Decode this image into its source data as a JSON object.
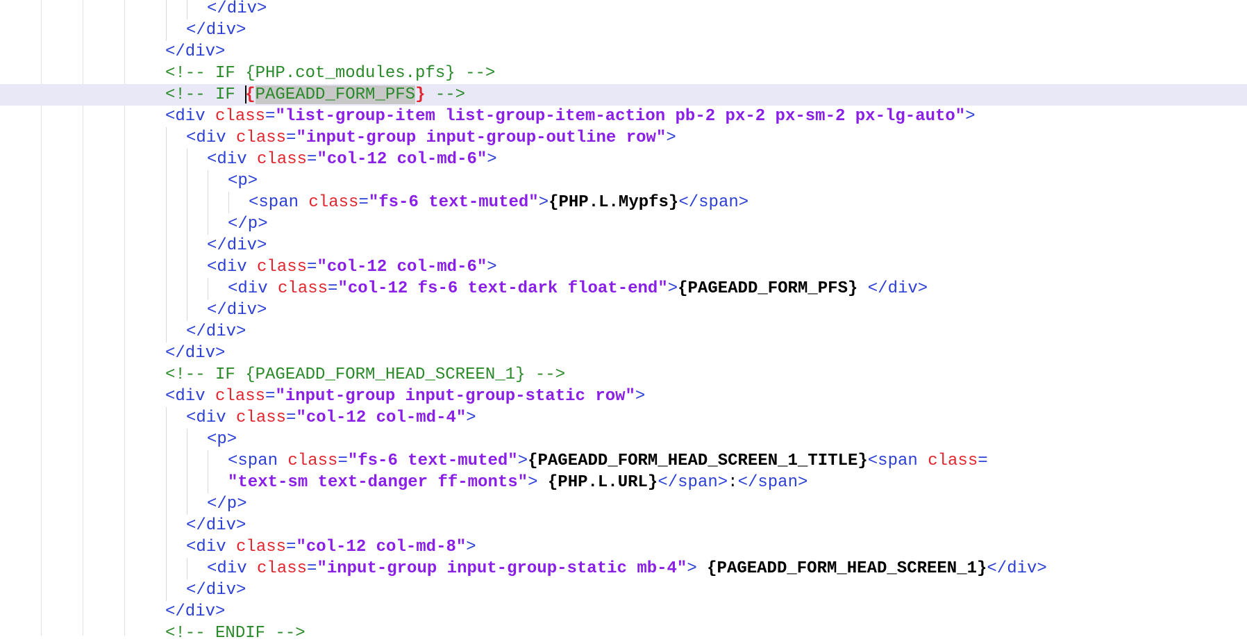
{
  "editor": {
    "lines": [
      {
        "indent": 10,
        "tokens": [
          {
            "k": "tag",
            "t": "</div>"
          }
        ]
      },
      {
        "indent": 9,
        "tokens": [
          {
            "k": "tag",
            "t": "</div>"
          }
        ]
      },
      {
        "indent": 8,
        "tokens": [
          {
            "k": "tag",
            "t": "</div>"
          }
        ]
      },
      {
        "indent": 8,
        "tokens": [
          {
            "k": "cmt",
            "t": "<!-- IF {PHP.cot_modules.pfs} -->"
          }
        ]
      },
      {
        "indent": 8,
        "current": true,
        "tokens": [
          {
            "k": "cmt",
            "t": "<!-- IF "
          },
          {
            "k": "caret",
            "t": ""
          },
          {
            "k": "brace",
            "t": "{"
          },
          {
            "k": "sel",
            "t": "PAGEADD_FORM_PFS"
          },
          {
            "k": "brace",
            "t": "}"
          },
          {
            "k": "cmt",
            "t": " -->"
          }
        ]
      },
      {
        "indent": 8,
        "tokens": [
          {
            "k": "tag",
            "t": "<div "
          },
          {
            "k": "attr",
            "t": "class"
          },
          {
            "k": "eq",
            "t": "="
          },
          {
            "k": "str",
            "t": "\"list-group-item list-group-item-action pb-2 px-2 px-sm-2 px-lg-auto\""
          },
          {
            "k": "tag",
            "t": ">"
          }
        ]
      },
      {
        "indent": 9,
        "tokens": [
          {
            "k": "tag",
            "t": "<div "
          },
          {
            "k": "attr",
            "t": "class"
          },
          {
            "k": "eq",
            "t": "="
          },
          {
            "k": "str",
            "t": "\"input-group input-group-outline row\""
          },
          {
            "k": "tag",
            "t": ">"
          }
        ]
      },
      {
        "indent": 10,
        "tokens": [
          {
            "k": "tag",
            "t": "<div "
          },
          {
            "k": "attr",
            "t": "class"
          },
          {
            "k": "eq",
            "t": "="
          },
          {
            "k": "str",
            "t": "\"col-12 col-md-6\""
          },
          {
            "k": "tag",
            "t": ">"
          }
        ]
      },
      {
        "indent": 11,
        "tokens": [
          {
            "k": "tag",
            "t": "<p>"
          }
        ]
      },
      {
        "indent": 12,
        "tokens": [
          {
            "k": "tag",
            "t": "<span "
          },
          {
            "k": "attr",
            "t": "class"
          },
          {
            "k": "eq",
            "t": "="
          },
          {
            "k": "str",
            "t": "\"fs-6 text-muted\""
          },
          {
            "k": "tag",
            "t": ">"
          },
          {
            "k": "tpl",
            "t": "{PHP.L.Mypfs}"
          },
          {
            "k": "tag",
            "t": "</span>"
          }
        ]
      },
      {
        "indent": 11,
        "tokens": [
          {
            "k": "tag",
            "t": "</p>"
          }
        ]
      },
      {
        "indent": 10,
        "tokens": [
          {
            "k": "tag",
            "t": "</div>"
          }
        ]
      },
      {
        "indent": 10,
        "tokens": [
          {
            "k": "tag",
            "t": "<div "
          },
          {
            "k": "attr",
            "t": "class"
          },
          {
            "k": "eq",
            "t": "="
          },
          {
            "k": "str",
            "t": "\"col-12 col-md-6\""
          },
          {
            "k": "tag",
            "t": ">"
          }
        ]
      },
      {
        "indent": 11,
        "tokens": [
          {
            "k": "tag",
            "t": "<div "
          },
          {
            "k": "attr",
            "t": "class"
          },
          {
            "k": "eq",
            "t": "="
          },
          {
            "k": "str",
            "t": "\"col-12 fs-6 text-dark float-end\""
          },
          {
            "k": "tag",
            "t": ">"
          },
          {
            "k": "tpl",
            "t": "{PAGEADD_FORM_PFS}"
          },
          {
            "k": "txt",
            "t": " "
          },
          {
            "k": "tag",
            "t": "</div>"
          }
        ]
      },
      {
        "indent": 10,
        "tokens": [
          {
            "k": "tag",
            "t": "</div>"
          }
        ]
      },
      {
        "indent": 9,
        "tokens": [
          {
            "k": "tag",
            "t": "</div>"
          }
        ]
      },
      {
        "indent": 8,
        "tokens": [
          {
            "k": "tag",
            "t": "</div>"
          }
        ]
      },
      {
        "indent": 8,
        "tokens": [
          {
            "k": "cmt",
            "t": "<!-- IF {PAGEADD_FORM_HEAD_SCREEN_1} -->"
          }
        ]
      },
      {
        "indent": 8,
        "tokens": [
          {
            "k": "tag",
            "t": "<div "
          },
          {
            "k": "attr",
            "t": "class"
          },
          {
            "k": "eq",
            "t": "="
          },
          {
            "k": "str",
            "t": "\"input-group input-group-static row\""
          },
          {
            "k": "tag",
            "t": ">"
          }
        ]
      },
      {
        "indent": 9,
        "tokens": [
          {
            "k": "tag",
            "t": "<div "
          },
          {
            "k": "attr",
            "t": "class"
          },
          {
            "k": "eq",
            "t": "="
          },
          {
            "k": "str",
            "t": "\"col-12 col-md-4\""
          },
          {
            "k": "tag",
            "t": ">"
          }
        ]
      },
      {
        "indent": 10,
        "tokens": [
          {
            "k": "tag",
            "t": "<p>"
          }
        ]
      },
      {
        "indent": 11,
        "tokens": [
          {
            "k": "tag",
            "t": "<span "
          },
          {
            "k": "attr",
            "t": "class"
          },
          {
            "k": "eq",
            "t": "="
          },
          {
            "k": "str",
            "t": "\"fs-6 text-muted\""
          },
          {
            "k": "tag",
            "t": ">"
          },
          {
            "k": "tpl",
            "t": "{PAGEADD_FORM_HEAD_SCREEN_1_TITLE}"
          },
          {
            "k": "tag",
            "t": "<span "
          },
          {
            "k": "attr",
            "t": "class"
          },
          {
            "k": "eq",
            "t": "="
          }
        ]
      },
      {
        "indent": 11,
        "wrapped": true,
        "tokens": [
          {
            "k": "str",
            "t": "\"text-sm text-danger ff-monts\""
          },
          {
            "k": "tag",
            "t": ">"
          },
          {
            "k": "txt",
            "t": " "
          },
          {
            "k": "tpl",
            "t": "{PHP.L.URL}"
          },
          {
            "k": "tag",
            "t": "</span>"
          },
          {
            "k": "txt",
            "t": ":"
          },
          {
            "k": "tag",
            "t": "</span>"
          }
        ]
      },
      {
        "indent": 10,
        "tokens": [
          {
            "k": "tag",
            "t": "</p>"
          }
        ]
      },
      {
        "indent": 9,
        "tokens": [
          {
            "k": "tag",
            "t": "</div>"
          }
        ]
      },
      {
        "indent": 9,
        "tokens": [
          {
            "k": "tag",
            "t": "<div "
          },
          {
            "k": "attr",
            "t": "class"
          },
          {
            "k": "eq",
            "t": "="
          },
          {
            "k": "str",
            "t": "\"col-12 col-md-8\""
          },
          {
            "k": "tag",
            "t": ">"
          }
        ]
      },
      {
        "indent": 10,
        "tokens": [
          {
            "k": "tag",
            "t": "<div "
          },
          {
            "k": "attr",
            "t": "class"
          },
          {
            "k": "eq",
            "t": "="
          },
          {
            "k": "str",
            "t": "\"input-group input-group-static mb-4\""
          },
          {
            "k": "tag",
            "t": ">"
          },
          {
            "k": "txt",
            "t": " "
          },
          {
            "k": "tpl",
            "t": "{PAGEADD_FORM_HEAD_SCREEN_1}"
          },
          {
            "k": "tag",
            "t": "</div>"
          }
        ]
      },
      {
        "indent": 9,
        "tokens": [
          {
            "k": "tag",
            "t": "</div>"
          }
        ]
      },
      {
        "indent": 8,
        "tokens": [
          {
            "k": "tag",
            "t": "</div>"
          }
        ]
      },
      {
        "indent": 8,
        "tokens": [
          {
            "k": "cmt",
            "t": "<!-- ENDIF -->"
          }
        ]
      }
    ]
  }
}
